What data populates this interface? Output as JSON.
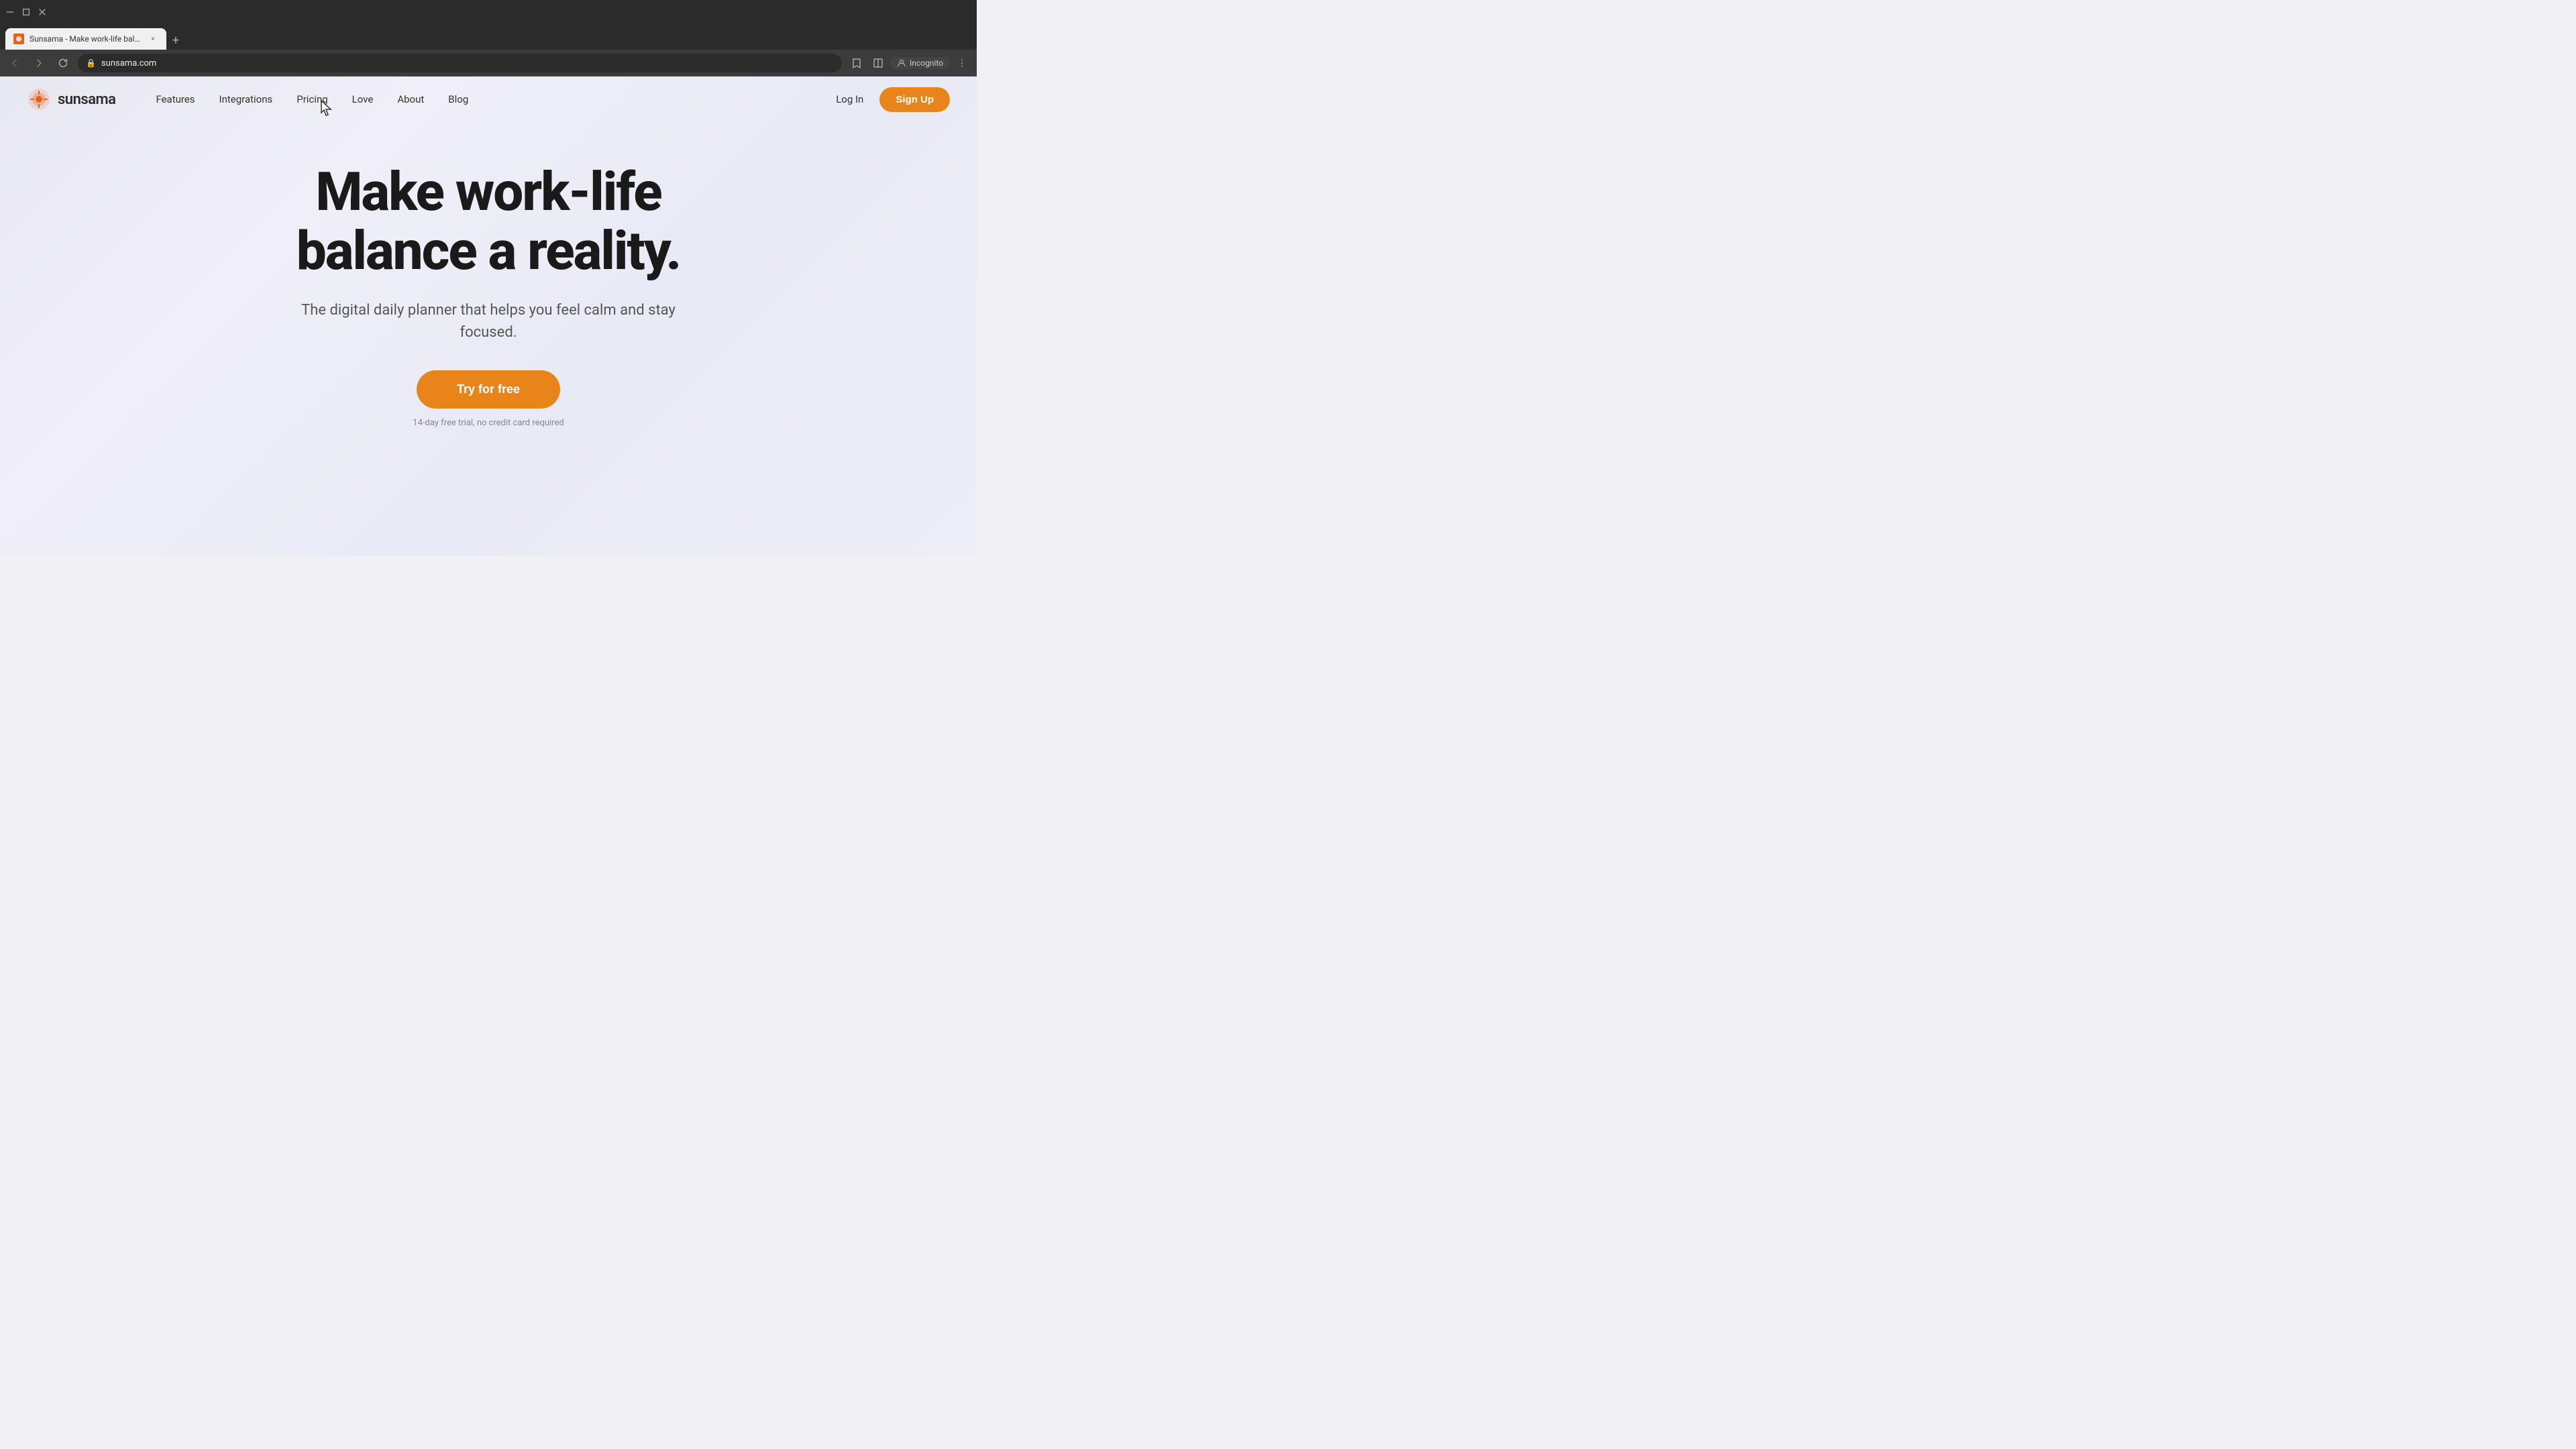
{
  "browser": {
    "tab": {
      "favicon_color": "#e8611a",
      "title": "Sunsama - Make work-life bala...",
      "close_label": "×"
    },
    "new_tab_label": "+",
    "back_btn": "←",
    "forward_btn": "→",
    "refresh_btn": "↻",
    "url": "sunsama.com",
    "star_icon": "☆",
    "split_icon": "⊡",
    "incognito_label": "Incognito",
    "more_btn": "⋮"
  },
  "nav": {
    "logo_text": "sunsama",
    "links": [
      {
        "label": "Features",
        "id": "features"
      },
      {
        "label": "Integrations",
        "id": "integrations"
      },
      {
        "label": "Pricing",
        "id": "pricing"
      },
      {
        "label": "Love",
        "id": "love"
      },
      {
        "label": "About",
        "id": "about"
      },
      {
        "label": "Blog",
        "id": "blog"
      }
    ],
    "login_label": "Log In",
    "signup_label": "Sign Up"
  },
  "hero": {
    "title_line1": "Make work-life",
    "title_line2": "balance a reality.",
    "subtitle": "The digital daily planner that helps you feel calm and stay focused.",
    "cta_label": "Try for free",
    "cta_note": "14-day free trial, no credit card required"
  }
}
